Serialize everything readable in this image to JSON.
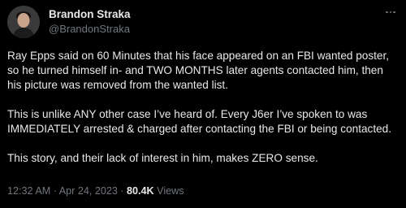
{
  "author": {
    "display_name": "Brandon Straka",
    "handle": "@BrandonStraka",
    "avatar_icon": "user-avatar"
  },
  "menu": {
    "icon": "more-options-icon"
  },
  "tweet": {
    "paragraphs": [
      "Ray Epps said on 60 Minutes that his face appeared on an FBI wanted poster, so he turned himself in- and TWO MONTHS later agents contacted him, then his picture was removed from the wanted list.",
      "This is unlike ANY other case I’ve heard of. Every J6er I’ve spoken to was IMMEDIATELY arrested & charged after contacting the FBI or being contacted.",
      "This story, and their lack of interest in him, makes ZERO sense."
    ]
  },
  "meta": {
    "time": "12:32 AM",
    "separator": " · ",
    "date": "Apr 24, 2023",
    "views_count": "80.4K",
    "views_label": " Views"
  },
  "colors": {
    "background": "#000000",
    "text": "#e7e9ea",
    "secondary": "#71767b"
  }
}
